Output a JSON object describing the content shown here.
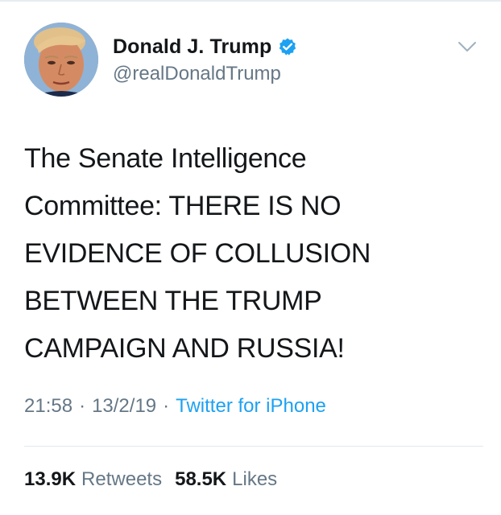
{
  "tweet": {
    "author": {
      "display_name": "Donald J. Trump",
      "handle": "@realDonaldTrump",
      "verified": true,
      "avatar_icon": "profile-photo"
    },
    "text": "The Senate Intelligence\nCommittee: THERE IS NO\nEVIDENCE OF COLLUSION\nBETWEEN THE TRUMP\nCAMPAIGN AND RUSSIA!",
    "meta": {
      "time": "21:58",
      "separator": "·",
      "date": "13/2/19",
      "source": "Twitter for iPhone"
    },
    "stats": {
      "retweets_count": "13.9K",
      "retweets_label": "Retweets",
      "likes_count": "58.5K",
      "likes_label": "Likes"
    }
  },
  "colors": {
    "primary_text": "#14171a",
    "secondary_text": "#657786",
    "accent_blue": "#1da1f2",
    "divider": "#e1e8ed"
  }
}
